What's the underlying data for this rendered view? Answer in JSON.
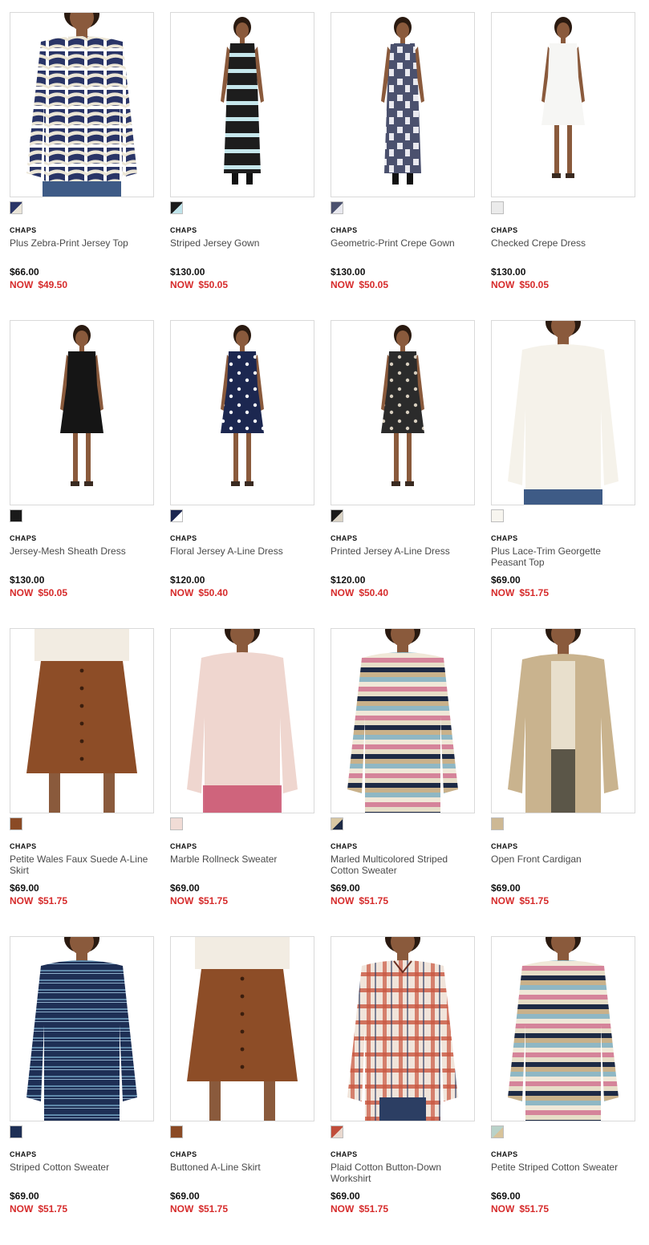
{
  "products": [
    {
      "brand": "CHAPS",
      "title": "Plus Zebra-Print Jersey Top",
      "price": "$66.00",
      "sale_label": "NOW",
      "sale_price": "$49.50",
      "swatch": "#2a3567",
      "swatch2": "#e9e4d8",
      "pattern": "zebra",
      "kind": "top",
      "cloth": "#2a3567",
      "cloth2": "#ece6d6"
    },
    {
      "brand": "CHAPS",
      "title": "Striped Jersey Gown",
      "price": "$130.00",
      "sale_label": "NOW",
      "sale_price": "$50.05",
      "swatch": "#1b1b1b",
      "swatch2": "#bfe3ea",
      "pattern": "hstripe",
      "kind": "gown",
      "cloth": "#1d1d1d",
      "cloth2": "#c6e7ec"
    },
    {
      "brand": "CHAPS",
      "title": "Geometric-Print Crepe Gown",
      "price": "$130.00",
      "sale_label": "NOW",
      "sale_price": "$50.05",
      "swatch": "#4b516e",
      "swatch2": "#e8e8ee",
      "pattern": "geo",
      "kind": "gown",
      "cloth": "#4b516e",
      "cloth2": "#e9e9ef"
    },
    {
      "brand": "CHAPS",
      "title": "Checked Crepe Dress",
      "price": "$130.00",
      "sale_label": "NOW",
      "sale_price": "$50.05",
      "swatch": "#ebebeb",
      "swatch2": "#ebebeb",
      "pattern": "solid",
      "kind": "dress",
      "cloth": "#f6f6f4",
      "cloth2": "#f6f6f4"
    },
    {
      "brand": "CHAPS",
      "title": "Jersey-Mesh Sheath Dress",
      "price": "$130.00",
      "sale_label": "NOW",
      "sale_price": "$50.05",
      "swatch": "#1a1a1a",
      "swatch2": "#1a1a1a",
      "pattern": "solid",
      "kind": "dress",
      "cloth": "#151515",
      "cloth2": "#151515"
    },
    {
      "brand": "CHAPS",
      "title": "Floral Jersey A-Line Dress",
      "price": "$120.00",
      "sale_label": "NOW",
      "sale_price": "$50.40",
      "swatch": "#1c2750",
      "swatch2": "#ffffff",
      "pattern": "dots",
      "kind": "dress",
      "cloth": "#1c2750",
      "cloth2": "#ffffff"
    },
    {
      "brand": "CHAPS",
      "title": "Printed Jersey A-Line Dress",
      "price": "$120.00",
      "sale_label": "NOW",
      "sale_price": "$50.40",
      "swatch": "#1a1a1a",
      "swatch2": "#d9d2c4",
      "pattern": "dots",
      "kind": "dress",
      "cloth": "#2b2b2b",
      "cloth2": "#d8cfbf"
    },
    {
      "brand": "CHAPS",
      "title": "Plus Lace-Trim Georgette Peasant Top",
      "price": "$69.00",
      "sale_label": "NOW",
      "sale_price": "$51.75",
      "swatch": "#f7f5ef",
      "swatch2": "#f7f5ef",
      "pattern": "solid",
      "kind": "top",
      "cloth": "#f5f2ea",
      "cloth2": "#e2dccd"
    },
    {
      "brand": "CHAPS",
      "title": "Petite Wales Faux Suede A-Line Skirt",
      "price": "$69.00",
      "sale_label": "NOW",
      "sale_price": "$51.75",
      "swatch": "#8a4a25",
      "swatch2": "#8a4a25",
      "pattern": "solid",
      "kind": "skirt",
      "cloth": "#8d4d27",
      "cloth2": "#6f3a1c"
    },
    {
      "brand": "CHAPS",
      "title": "Marble Rollneck Sweater",
      "price": "$69.00",
      "sale_label": "NOW",
      "sale_price": "$51.75",
      "swatch": "#f1dcd6",
      "swatch2": "#f1dcd6",
      "pattern": "solid",
      "kind": "sweater",
      "cloth": "#efd6cf",
      "cloth2": "#c9506d"
    },
    {
      "brand": "CHAPS",
      "title": "Marled Multicolored Striped Cotton Sweater",
      "price": "$69.00",
      "sale_label": "NOW",
      "sale_price": "$51.75",
      "swatch": "#d8c7a3",
      "swatch2": "#1d2a45",
      "pattern": "multistripe",
      "kind": "sweater",
      "cloth": "#d5849a",
      "cloth2": "#1d2a45"
    },
    {
      "brand": "CHAPS",
      "title": "Open Front Cardigan",
      "price": "$69.00",
      "sale_label": "NOW",
      "sale_price": "$51.75",
      "swatch": "#cdb894",
      "swatch2": "#cdb894",
      "pattern": "solid",
      "kind": "cardigan",
      "cloth": "#c9b38e",
      "cloth2": "#5b5648"
    },
    {
      "brand": "CHAPS",
      "title": "Striped Cotton Sweater",
      "price": "$69.00",
      "sale_label": "NOW",
      "sale_price": "$51.75",
      "swatch": "#1e2f55",
      "swatch2": "#1e2f55",
      "pattern": "bluestripe",
      "kind": "sweater",
      "cloth": "#1e2f55",
      "cloth2": "#5d86a8"
    },
    {
      "brand": "CHAPS",
      "title": "Buttoned A-Line Skirt",
      "price": "$69.00",
      "sale_label": "NOW",
      "sale_price": "$51.75",
      "swatch": "#8a4a25",
      "swatch2": "#8a4a25",
      "pattern": "solid",
      "kind": "skirt",
      "cloth": "#8d4d27",
      "cloth2": "#6f3a1c"
    },
    {
      "brand": "CHAPS",
      "title": "Plaid Cotton Button-Down Workshirt",
      "price": "$69.00",
      "sale_label": "NOW",
      "sale_price": "$51.75",
      "swatch": "#c04c3a",
      "swatch2": "#e9d9cf",
      "pattern": "plaid",
      "kind": "shirt",
      "cloth": "#c9553f",
      "cloth2": "#f1e4da"
    },
    {
      "brand": "CHAPS",
      "title": "Petite Striped Cotton Sweater",
      "price": "$69.00",
      "sale_label": "NOW",
      "sale_price": "$51.75",
      "swatch": "#b9d2c9",
      "swatch2": "#d8c39a",
      "pattern": "multistripe",
      "kind": "sweater",
      "cloth": "#d5849a",
      "cloth2": "#1d2a45"
    }
  ]
}
